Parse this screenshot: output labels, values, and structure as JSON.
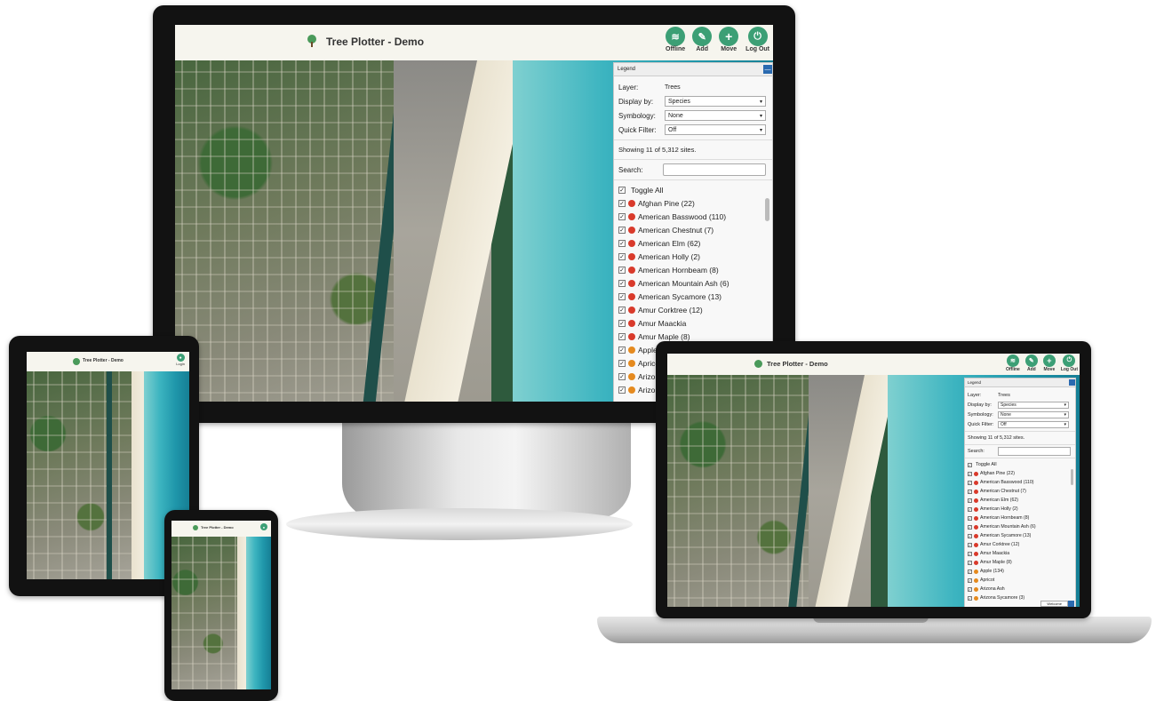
{
  "app": {
    "title": "Tree Plotter - Demo",
    "actions": [
      {
        "label": "Offline",
        "icon": "wifi-icon"
      },
      {
        "label": "Add",
        "icon": "pencil-icon"
      },
      {
        "label": "Move",
        "icon": "plus-icon"
      },
      {
        "label": "Log Out",
        "icon": "power-icon"
      }
    ],
    "mobile_action": "Login"
  },
  "legend": {
    "header": "Legend",
    "collapse_label": "—",
    "layer_label": "Layer:",
    "layer_value": "Trees",
    "display_by_label": "Display by:",
    "display_by_value": "Species",
    "symbology_label": "Symbology:",
    "symbology_value": "None",
    "quick_filter_label": "Quick Filter:",
    "quick_filter_value": "Off",
    "showing": "Showing 11 of 5,312 sites.",
    "search_label": "Search:",
    "search_value": "",
    "toggle_all": "Toggle All",
    "species": [
      {
        "name": "Afghan Pine (22)",
        "color": "#d93a2b"
      },
      {
        "name": "American Basswood (110)",
        "color": "#d93a2b"
      },
      {
        "name": "American Chestnut (7)",
        "color": "#d93a2b"
      },
      {
        "name": "American Elm (62)",
        "color": "#d93a2b"
      },
      {
        "name": "American Holly (2)",
        "color": "#d93a2b"
      },
      {
        "name": "American Hornbeam (8)",
        "color": "#d93a2b"
      },
      {
        "name": "American Mountain Ash (6)",
        "color": "#d93a2b"
      },
      {
        "name": "American Sycamore (13)",
        "color": "#d93a2b"
      },
      {
        "name": "Amur Corktree (12)",
        "color": "#d93a2b"
      },
      {
        "name": "Amur Maackia",
        "color": "#d93a2b"
      },
      {
        "name": "Amur Maple (8)",
        "color": "#d93a2b"
      },
      {
        "name": "Apple (134)",
        "color": "#e58a1f"
      },
      {
        "name": "Apricot",
        "color": "#e58a1f"
      },
      {
        "name": "Arizona Ash",
        "color": "#e58a1f"
      },
      {
        "name": "Arizona Sycamore (3)",
        "color": "#e58a1f"
      }
    ],
    "welcome_label": "Welcome"
  },
  "colors": {
    "accent": "#3c9f75",
    "sea": "#2aa8b8",
    "bezel": "#121212"
  }
}
